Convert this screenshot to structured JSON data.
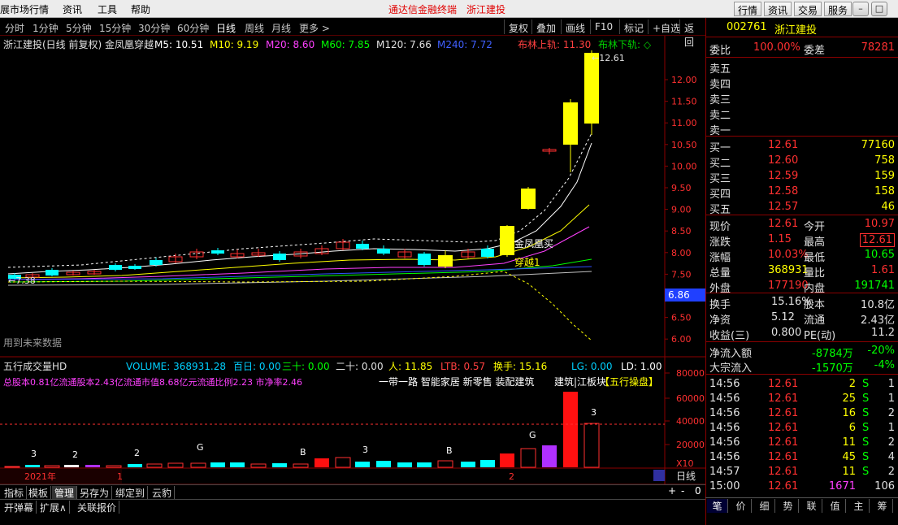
{
  "menu": {
    "items": [
      "展市场行情",
      "资讯",
      "工具",
      "帮助"
    ],
    "center_title": "通达信金融终端",
    "center_stock": "浙江建投",
    "right_buttons": [
      "行情",
      "资讯",
      "交易",
      "服务"
    ]
  },
  "periods": {
    "items": [
      "分时",
      "1分钟",
      "5分钟",
      "15分钟",
      "30分钟",
      "60分钟",
      "日线",
      "周线",
      "月线",
      "更多 >"
    ],
    "active": "日线",
    "tools": [
      "复权",
      "叠加",
      "画线",
      "F10",
      "标记",
      "+自选",
      "返回"
    ]
  },
  "chart_header": {
    "title": "浙江建投(日线 前复权) 金凤凰穿越",
    "ma5": "M5: 10.51",
    "ma10": "M10: 9.19",
    "ma20": "M20: 8.60",
    "ma60": "M60: 7.85",
    "ma120": "M120: 7.66",
    "ma240": "M240: 7.72",
    "boll_up": "布林上轨: 11.30",
    "boll_down": "布林下轨: ◇"
  },
  "chart_labels": {
    "high_marker": "12.61",
    "low_marker": "7.38",
    "current_price_tag": "6.86",
    "buy_signal": "金凤凰买",
    "cross_signal": "穿越1",
    "future_data": "用到未来数据"
  },
  "volume_header": {
    "title": "五行成交量HD",
    "volume": "VOLUME: 368931.28",
    "bai_ri": "百日: 0.00",
    "san_shi": "三十: 0.00",
    "er_shi": "二十: 0.00",
    "ren": "人: 11.85",
    "ltb": "LTB: 0.57",
    "huan_shou": "换手: 15.16",
    "lg": "LG: 0.00",
    "ld": "LD: 1.00"
  },
  "volume_info": {
    "share_info": "总股本0.81亿流通股本2.43亿流通市值8.68亿元流通比例2.23  市净率2.46",
    "concepts": "一带一路 智能家居 新零售 装配建筑",
    "region": "建筑|江板块",
    "watermark": "【五行操盘】"
  },
  "volume_bar_labels": [
    "3",
    "2",
    "2",
    "G",
    "B",
    "3",
    "B",
    "G",
    "3"
  ],
  "x_axis": {
    "year": "2021年",
    "month1": "1",
    "month2": "2",
    "period": "日线"
  },
  "y_axis_price": [
    "12.00",
    "11.50",
    "11.00",
    "10.50",
    "10.00",
    "9.50",
    "9.00",
    "8.50",
    "8.00",
    "7.50",
    "7.00",
    "6.50",
    "6.00"
  ],
  "y_axis_volume": [
    "80000",
    "60000",
    "40000",
    "20000",
    "X10"
  ],
  "quote": {
    "code": "002761",
    "name": "浙江建投",
    "wei_bi_label": "委比",
    "wei_bi": "100.00%",
    "wei_cha_label": "委差",
    "wei_cha": "78281",
    "sells": [
      "卖五",
      "卖四",
      "卖三",
      "卖二",
      "卖一"
    ],
    "buys": [
      {
        "label": "买一",
        "price": "12.61",
        "vol": "77160"
      },
      {
        "label": "买二",
        "price": "12.60",
        "vol": "758"
      },
      {
        "label": "买三",
        "price": "12.59",
        "vol": "159"
      },
      {
        "label": "买四",
        "price": "12.58",
        "vol": "158"
      },
      {
        "label": "买五",
        "price": "12.57",
        "vol": "46"
      }
    ],
    "stats": [
      {
        "l1": "现价",
        "v1": "12.61",
        "l2": "今开",
        "v2": "10.97"
      },
      {
        "l1": "涨跌",
        "v1": "1.15",
        "l2": "最高",
        "v2": "12.61"
      },
      {
        "l1": "涨幅",
        "v1": "10.03%",
        "l2": "最低",
        "v2": "10.65"
      },
      {
        "l1": "总量",
        "v1": "368931",
        "l2": "量比",
        "v2": "1.61"
      },
      {
        "l1": "外盘",
        "v1": "177190",
        "l2": "内盘",
        "v2": "191741"
      }
    ],
    "stats2": [
      {
        "l1": "换手",
        "v1": "15.16%",
        "l2": "股本",
        "v2": "10.8亿"
      },
      {
        "l1": "净资",
        "v1": "5.12",
        "l2": "流通",
        "v2": "2.43亿"
      },
      {
        "l1": "收益(三)",
        "v1": "0.800",
        "l2": "PE(动)",
        "v2": "11.2"
      }
    ],
    "flow": [
      {
        "label": "净流入额",
        "amount": "-8784万",
        "pct": "-20%"
      },
      {
        "label": "大宗流入",
        "amount": "-1570万",
        "pct": "-4%"
      }
    ],
    "ticks": [
      {
        "time": "14:56",
        "price": "12.61",
        "vol": "2",
        "bs": "S",
        "n": "1"
      },
      {
        "time": "14:56",
        "price": "12.61",
        "vol": "25",
        "bs": "S",
        "n": "1"
      },
      {
        "time": "14:56",
        "price": "12.61",
        "vol": "16",
        "bs": "S",
        "n": "2"
      },
      {
        "time": "14:56",
        "price": "12.61",
        "vol": "6",
        "bs": "S",
        "n": "1"
      },
      {
        "time": "14:56",
        "price": "12.61",
        "vol": "11",
        "bs": "S",
        "n": "2"
      },
      {
        "time": "14:56",
        "price": "12.61",
        "vol": "45",
        "bs": "S",
        "n": "4"
      },
      {
        "time": "14:57",
        "price": "12.61",
        "vol": "11",
        "bs": "S",
        "n": "2"
      },
      {
        "time": "15:00",
        "price": "12.61",
        "vol": "1671",
        "bs": "",
        "n": "106"
      }
    ],
    "bottom_tabs": [
      "笔",
      "价",
      "细",
      "势",
      "联",
      "值",
      "主",
      "筹"
    ]
  },
  "bottom_tabs_row1": [
    "指标",
    "模板",
    "管理",
    "另存为",
    "绑定到",
    "云豹"
  ],
  "bottom_tabs_row2": [
    "开弹幕",
    "扩展∧",
    "关联报价"
  ],
  "colors": {
    "up": "#ff3030",
    "down": "#00ffff",
    "yellow": "#ffff00",
    "purple": "#b030ff",
    "green": "#00d000",
    "grid": "#7a0000"
  }
}
